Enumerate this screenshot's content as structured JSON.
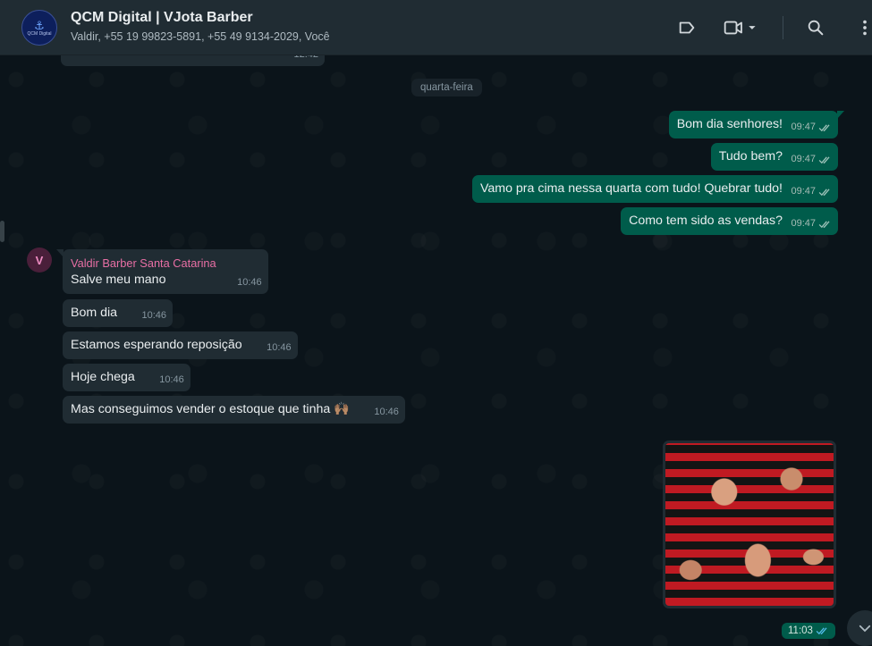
{
  "header": {
    "avatar_text": "QCM Digital",
    "title": "QCM Digital | VJota Barber",
    "subtitle": "Valdir, +55 19 99823-5891, +55 49 9134-2029, Você"
  },
  "chat": {
    "previous_time": "12:42",
    "date_label": "quarta-feira",
    "outgoing": [
      {
        "text": "Bom dia senhores!",
        "time": "09:47"
      },
      {
        "text": "Tudo bem?",
        "time": "09:47"
      },
      {
        "text": "Vamo pra cima nessa quarta com tudo! Quebrar tudo!",
        "time": "09:47"
      },
      {
        "text": "Como tem sido as vendas?",
        "time": "09:47"
      }
    ],
    "sender": {
      "initial": "V",
      "name": "Valdir Barber Santa Catarina"
    },
    "incoming": [
      {
        "text": "Salve meu mano",
        "time": "10:46"
      },
      {
        "text": "Bom dia",
        "time": "10:46"
      },
      {
        "text": "Estamos esperando reposição",
        "time": "10:46"
      },
      {
        "text": "Hoje chega",
        "time": "10:46"
      },
      {
        "text": "Mas conseguimos vender o estoque que tinha 🙌🏽",
        "time": "10:46"
      }
    ],
    "image_time": "11:03"
  },
  "colors": {
    "outgoing_bubble": "#005c4b",
    "incoming_bubble": "#202c33",
    "sender_name": "#e86fa5",
    "read_check": "#53bdeb"
  }
}
